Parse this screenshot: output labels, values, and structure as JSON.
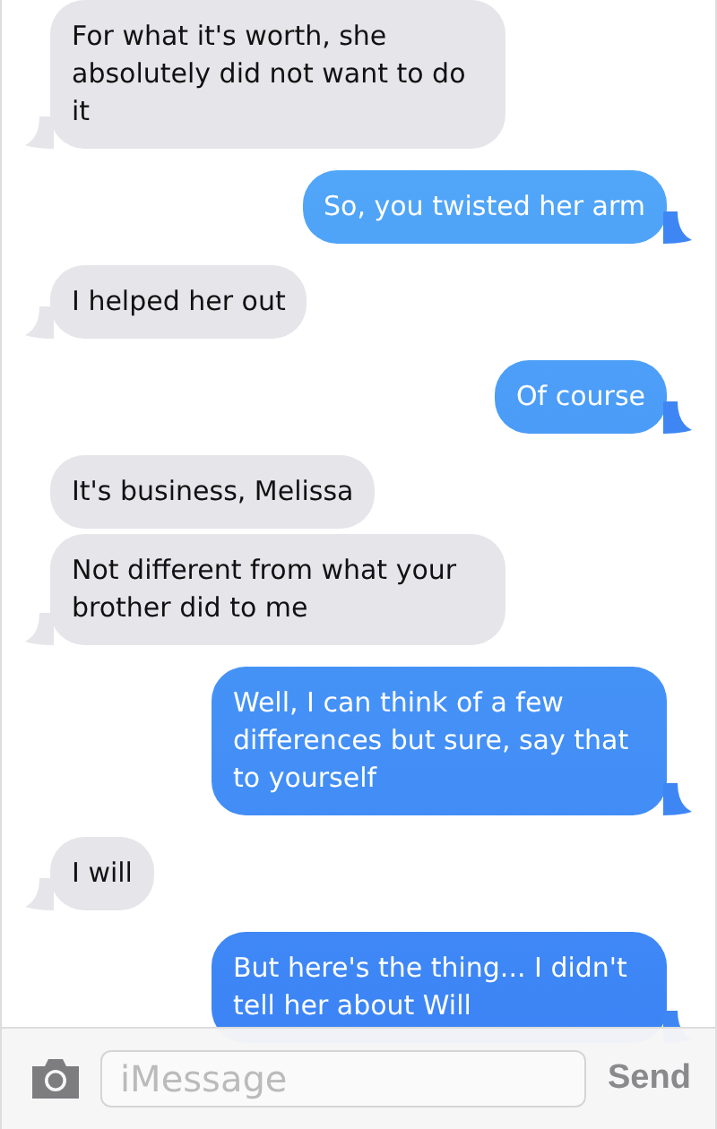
{
  "messages": [
    {
      "kind": "incoming",
      "text": "For what it's worth, she absolutely did not want to do it",
      "tail": true
    },
    {
      "kind": "outgoing",
      "text": "So, you twisted her arm",
      "tail": true
    },
    {
      "kind": "incoming",
      "text": "I helped her out",
      "tail": true
    },
    {
      "kind": "outgoing",
      "text": "Of course",
      "tail": true
    },
    {
      "kind": "incoming",
      "text": "It's business, Melissa",
      "tail": false
    },
    {
      "kind": "incoming",
      "text": "Not different from what your brother did to me",
      "tail": true
    },
    {
      "kind": "outgoing",
      "text": "Well, I can think of a few differences but sure, say that to yourself",
      "tail": true
    },
    {
      "kind": "incoming",
      "text": "I will",
      "tail": true
    },
    {
      "kind": "outgoing",
      "text": "But here's the thing... I didn't tell her about Will",
      "tail": true
    }
  ],
  "composer": {
    "placeholder": "iMessage",
    "send_label": "Send"
  }
}
